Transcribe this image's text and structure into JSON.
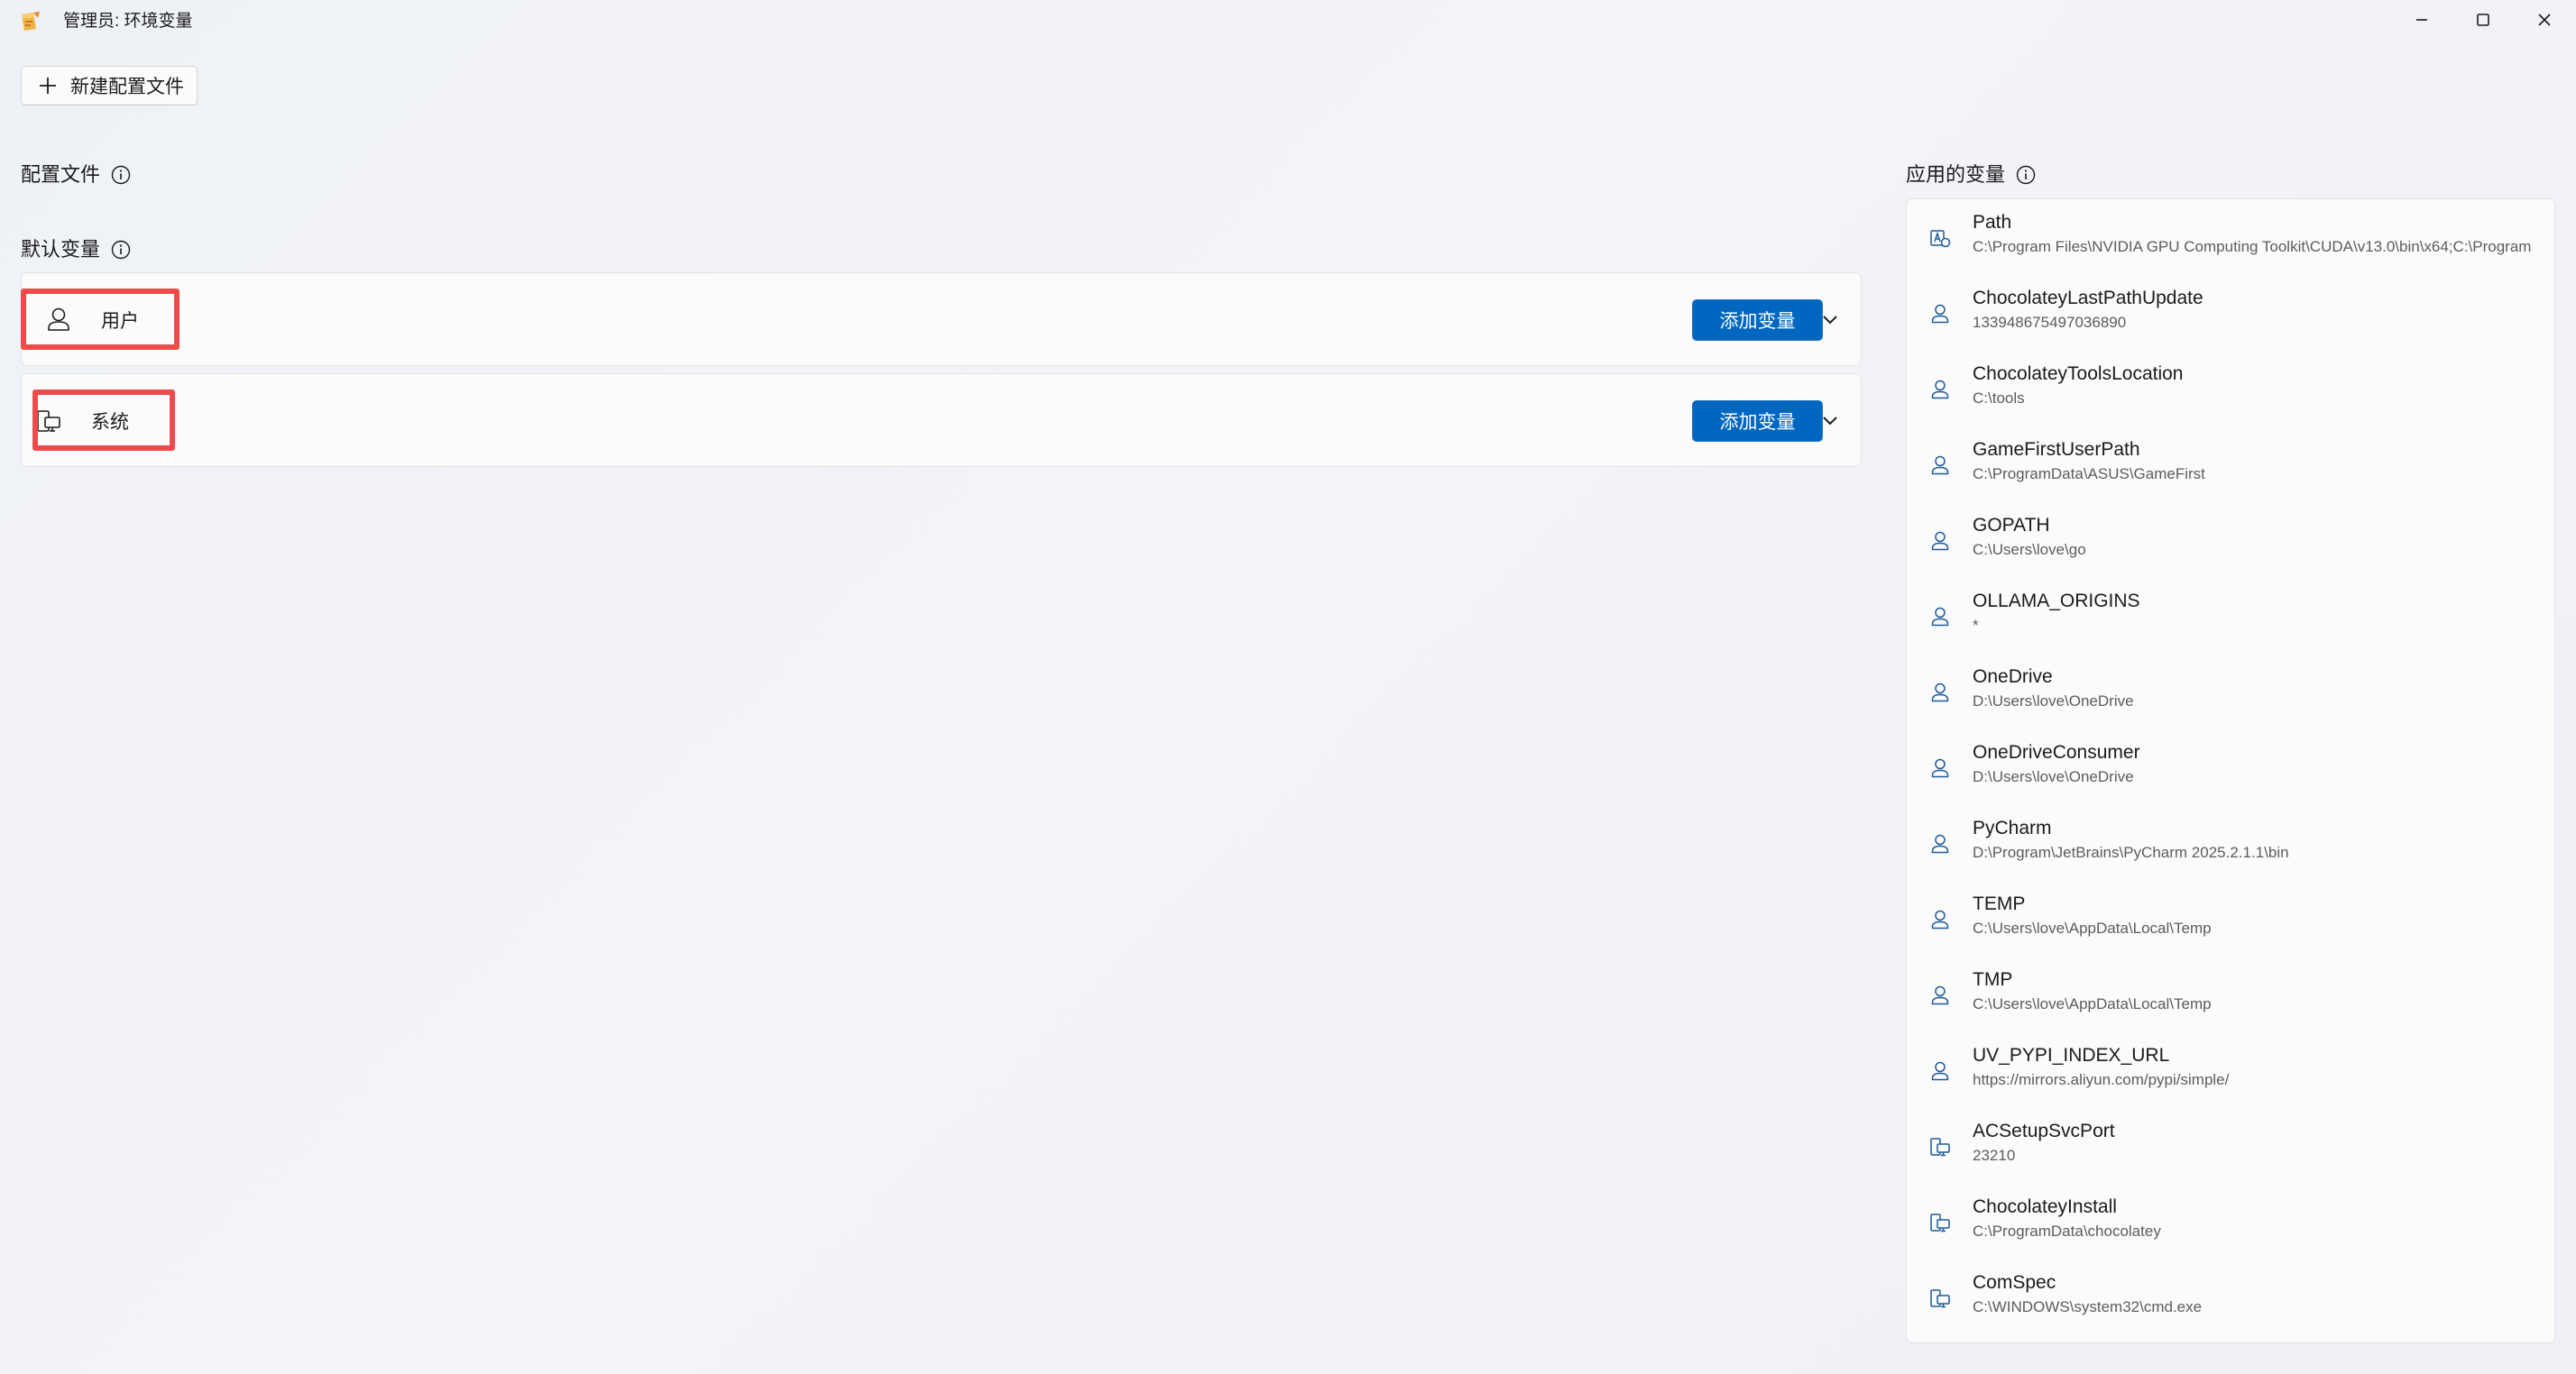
{
  "window": {
    "title": "管理员: 环境变量"
  },
  "toolbar": {
    "new_profile_label": "新建配置文件"
  },
  "sections": {
    "profiles_label": "配置文件",
    "defaults_label": "默认变量",
    "applied_label": "应用的变量"
  },
  "default_cards": {
    "user": {
      "label": "用户",
      "add_label": "添加变量"
    },
    "system": {
      "label": "系统",
      "add_label": "添加变量"
    }
  },
  "applied_variables": [
    {
      "name": "Path",
      "value": "C:\\Program Files\\NVIDIA GPU Computing Toolkit\\CUDA\\v13.0\\bin\\x64;C:\\Program",
      "icon": "path-variable-icon"
    },
    {
      "name": "ChocolateyLastPathUpdate",
      "value": "133948675497036890",
      "icon": "user-icon"
    },
    {
      "name": "ChocolateyToolsLocation",
      "value": "C:\\tools",
      "icon": "user-icon"
    },
    {
      "name": "GameFirstUserPath",
      "value": "C:\\ProgramData\\ASUS\\GameFirst",
      "icon": "user-icon"
    },
    {
      "name": "GOPATH",
      "value": "C:\\Users\\love\\go",
      "icon": "user-icon"
    },
    {
      "name": "OLLAMA_ORIGINS",
      "value": "*",
      "icon": "user-icon"
    },
    {
      "name": "OneDrive",
      "value": "D:\\Users\\love\\OneDrive",
      "icon": "user-icon"
    },
    {
      "name": "OneDriveConsumer",
      "value": "D:\\Users\\love\\OneDrive",
      "icon": "user-icon"
    },
    {
      "name": "PyCharm",
      "value": "D:\\Program\\JetBrains\\PyCharm 2025.2.1.1\\bin",
      "icon": "user-icon"
    },
    {
      "name": "TEMP",
      "value": "C:\\Users\\love\\AppData\\Local\\Temp",
      "icon": "user-icon"
    },
    {
      "name": "TMP",
      "value": "C:\\Users\\love\\AppData\\Local\\Temp",
      "icon": "user-icon"
    },
    {
      "name": "UV_PYPI_INDEX_URL",
      "value": "https://mirrors.aliyun.com/pypi/simple/",
      "icon": "user-icon"
    },
    {
      "name": "ACSetupSvcPort",
      "value": "23210",
      "icon": "system-icon"
    },
    {
      "name": "ChocolateyInstall",
      "value": "C:\\ProgramData\\chocolatey",
      "icon": "system-icon"
    },
    {
      "name": "ComSpec",
      "value": "C:\\WINDOWS\\system32\\cmd.exe",
      "icon": "system-icon"
    }
  ],
  "colors": {
    "accent": "#0067c0",
    "highlight": "#ef4b4b"
  }
}
